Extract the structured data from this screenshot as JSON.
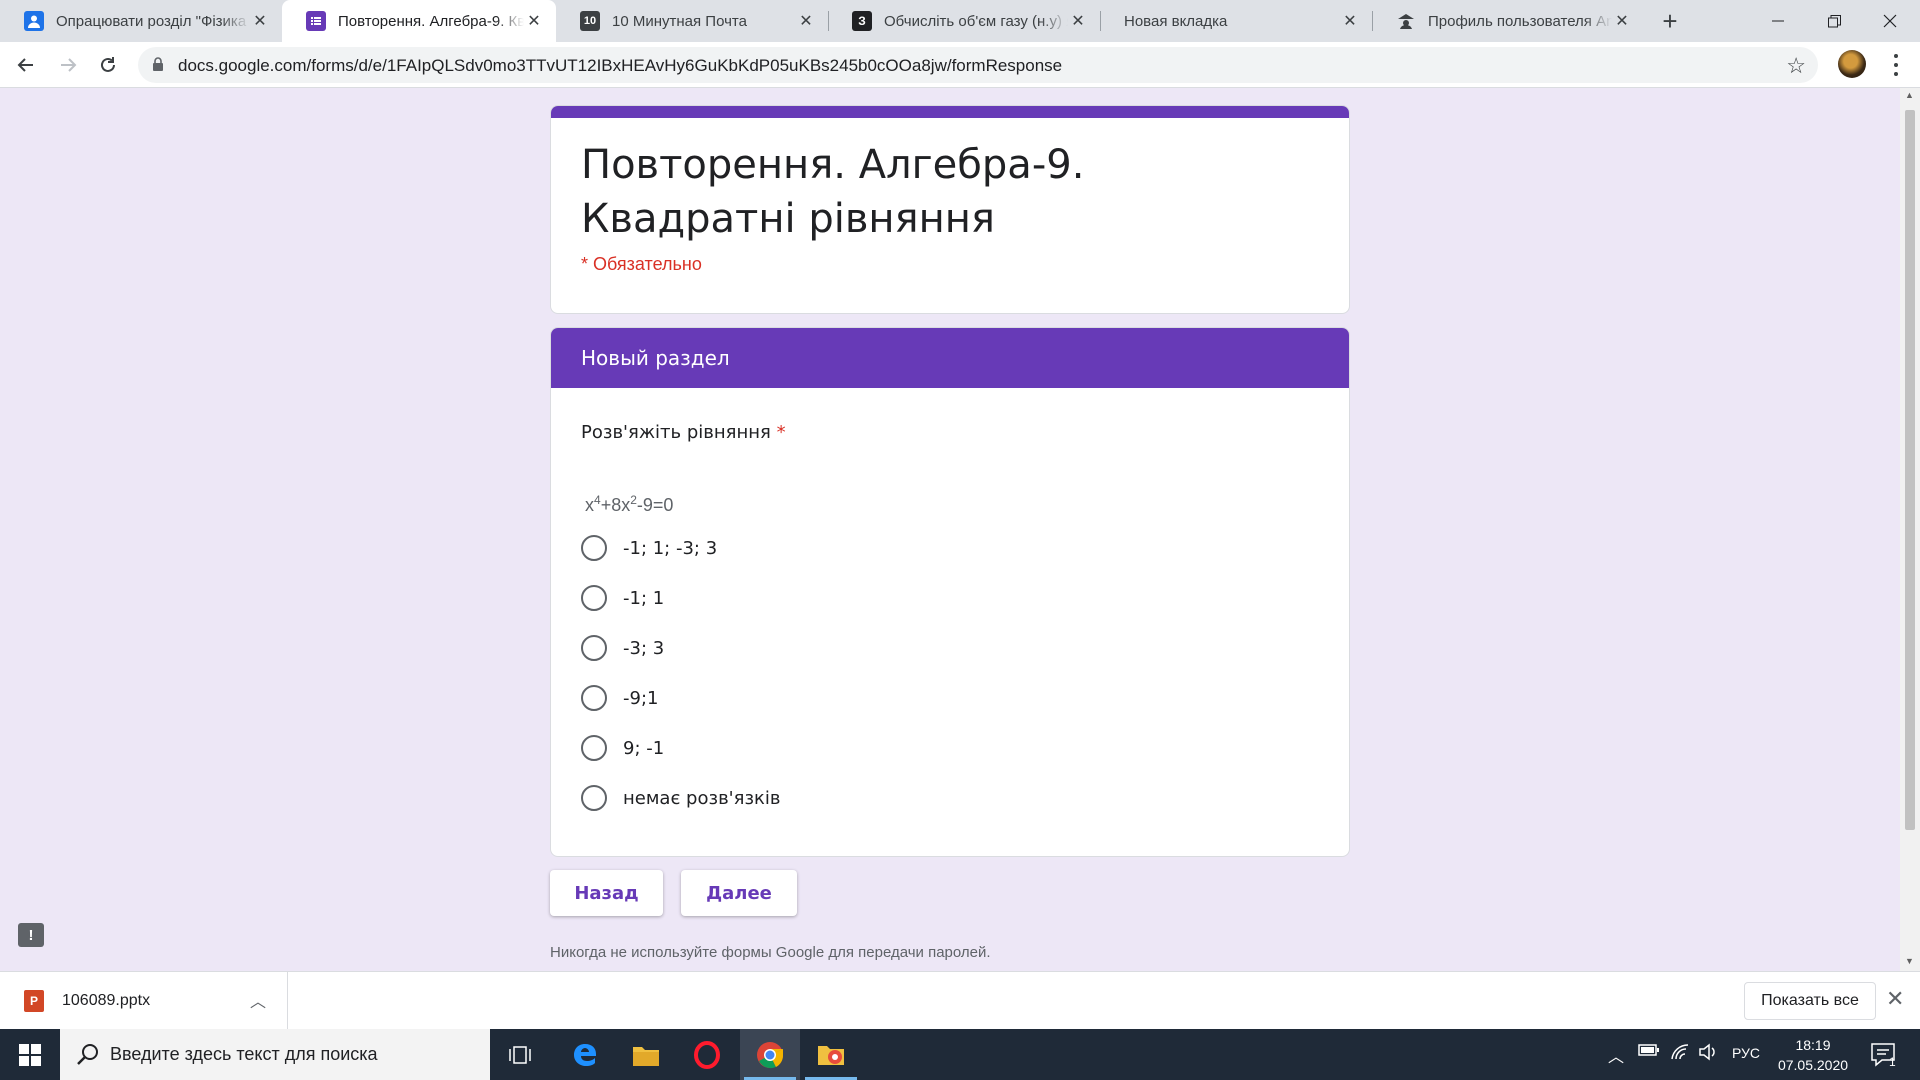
{
  "browser": {
    "tabs": [
      {
        "title": "Опрацювати розділ \"Фізика",
        "icon": "classroom-icon"
      },
      {
        "title": "Повторення. Алгебра-9. Ква",
        "icon": "google-forms-icon"
      },
      {
        "title": "10 Минутная Почта",
        "icon": "10minutemail-icon"
      },
      {
        "title": "Обчисліть об'єм газу (н.у) я",
        "icon": "znanija-icon"
      },
      {
        "title": "Новая вкладка",
        "icon": ""
      },
      {
        "title": "Профиль пользователя Anc",
        "icon": "user-profile-icon"
      }
    ],
    "url": "docs.google.com/forms/d/e/1FAIpQLSdv0mo3TTvUT12IBxHEAvHy6GuKbKdP05uKBs245b0cOOa8jw/formResponse"
  },
  "form": {
    "title": "Повторення. Алгебра-9. Квадратні рівняння",
    "required_note": "* Обязательно",
    "section_title": "Новый раздел",
    "question": "Розв'яжіть рівняння",
    "required_mark": "*",
    "equation": {
      "x": "x",
      "exp1": "4",
      "mid": "+8x",
      "exp2": "2",
      "tail": "-9=0"
    },
    "options": [
      "-1; 1; -3; 3",
      "-1; 1",
      "-3; 3",
      "-9;1",
      "9; -1",
      "немає розв'язків"
    ],
    "back_label": "Назад",
    "next_label": "Далее",
    "footer_note": "Никогда не используйте формы Google для передачи паролей.",
    "accent_color": "#673ab7"
  },
  "downloads": {
    "file_name": "106089.pptx",
    "show_all_label": "Показать все"
  },
  "taskbar": {
    "search_placeholder": "Введите здесь текст для поиска",
    "language": "РУС",
    "time": "18:19",
    "date": "07.05.2020",
    "notification_count": "1"
  }
}
